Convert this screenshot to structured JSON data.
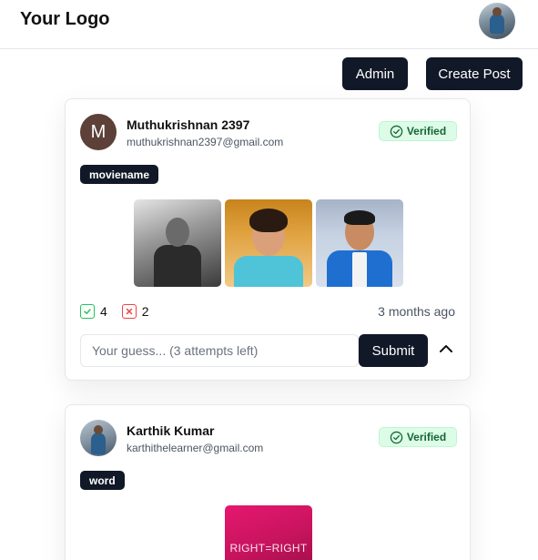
{
  "header": {
    "logo": "Your Logo",
    "avatar_icon": "user-avatar"
  },
  "actions": {
    "admin_label": "Admin",
    "create_post_label": "Create Post"
  },
  "posts": [
    {
      "user_name": "Muthukrishnan 2397",
      "email": "muthukrishnan2397@gmail.com",
      "avatar_letter": "M",
      "verified_label": "Verified",
      "tag": "moviename",
      "images": [
        "actor-photo-1",
        "actress-photo-2",
        "actor-photo-3"
      ],
      "correct_count": "4",
      "wrong_count": "2",
      "time": "3 months ago",
      "guess_placeholder": "Your guess... (3 attempts left)",
      "submit_label": "Submit"
    },
    {
      "user_name": "Karthik Kumar",
      "email": "karthithelearner@gmail.com",
      "verified_label": "Verified",
      "tag": "word",
      "image_text": "RIGHT=RIGHT"
    }
  ],
  "colors": {
    "dark": "#111827",
    "verified_bg": "#dcfce7",
    "verified_text": "#166534",
    "correct": "#22c55e",
    "wrong": "#ef4444"
  }
}
